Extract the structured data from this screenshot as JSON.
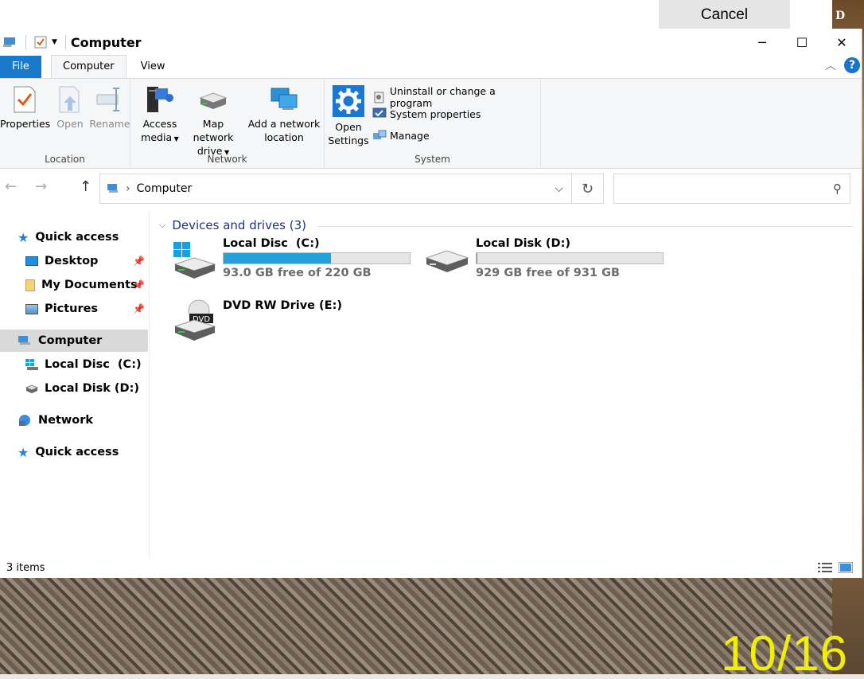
{
  "background": {
    "cancel_label": "Cancel",
    "corner_text": "D",
    "date_stamp": "10/16"
  },
  "window": {
    "title": "Computer",
    "controls": {
      "minimize": "─",
      "maximize": "☐",
      "close": "✕"
    }
  },
  "ribbon": {
    "tabs": [
      "File",
      "Computer",
      "View"
    ],
    "groups": {
      "location": {
        "label": "Location",
        "properties": "Properties",
        "open": "Open",
        "rename": "Rename"
      },
      "network": {
        "label": "Network",
        "access_media_1": "Access",
        "access_media_2": "media",
        "map_drive_1": "Map network",
        "map_drive_2": "drive",
        "add_location_1": "Add a network",
        "add_location_2": "location"
      },
      "system": {
        "label": "System",
        "open_settings_1": "Open",
        "open_settings_2": "Settings",
        "uninstall": "Uninstall or change a program",
        "system_properties": "System properties",
        "manage": "Manage"
      }
    }
  },
  "address": {
    "path": "Computer",
    "search_placeholder": ""
  },
  "nav_pane": {
    "quick_access": "Quick access",
    "desktop": "Desktop",
    "documents": "My Documents",
    "pictures": "Pictures",
    "computer": "Computer",
    "local_c": "Local Disc  (C:)",
    "local_d": "Local Disk (D:)",
    "network": "Network",
    "quick_access_2": "Quick access"
  },
  "content": {
    "section_title": "Devices and drives (3)",
    "drives": [
      {
        "name": "Local Disc  (C:)",
        "free": "93.0 GB free of 220 GB",
        "used_fraction": 0.577
      },
      {
        "name": "Local Disk (D:)",
        "free": "929 GB free of 931 GB",
        "used_fraction": 0.002
      },
      {
        "name": "DVD RW Drive (E:)",
        "icon_text": "DVD"
      }
    ]
  },
  "status": {
    "items": "3 items"
  },
  "colors": {
    "accent": "#1979ca",
    "bar_fill": "#26a0da",
    "section_header": "#1e3287"
  }
}
